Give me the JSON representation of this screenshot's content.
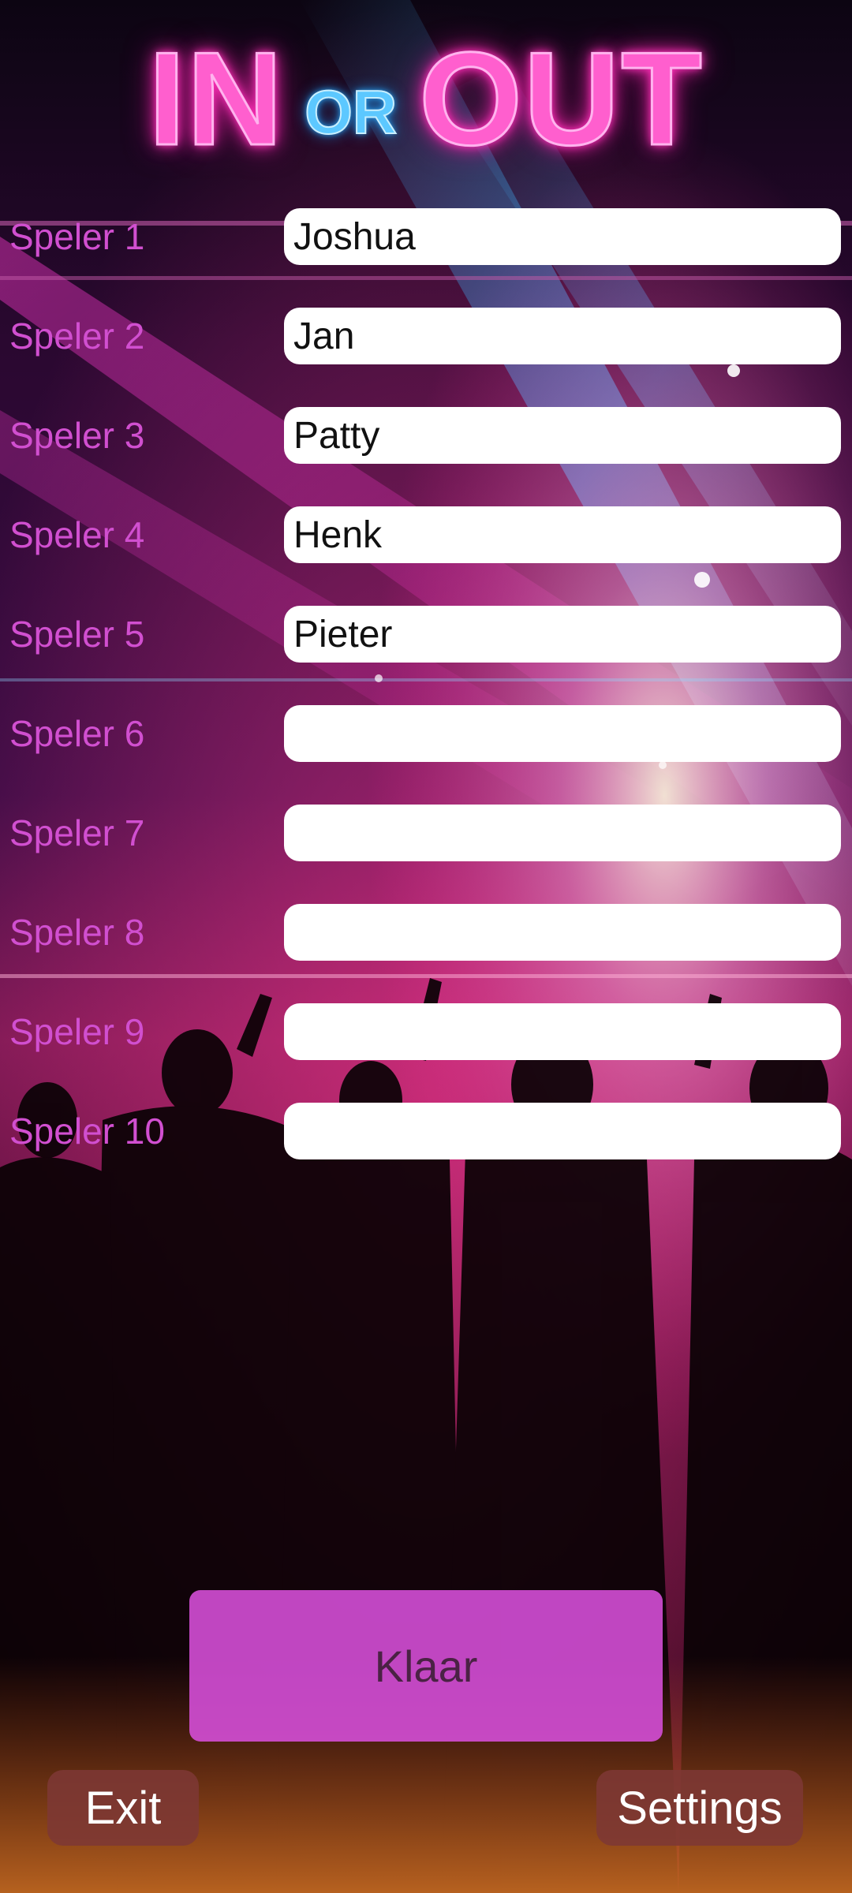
{
  "logo": {
    "word_in": "IN",
    "word_or": "OR",
    "word_out": "OUT"
  },
  "players": [
    {
      "label": "Speler 1",
      "value": "Joshua"
    },
    {
      "label": "Speler 2",
      "value": "Jan"
    },
    {
      "label": "Speler 3",
      "value": "Patty"
    },
    {
      "label": "Speler 4",
      "value": "Henk"
    },
    {
      "label": "Speler 5",
      "value": "Pieter"
    },
    {
      "label": "Speler 6",
      "value": ""
    },
    {
      "label": "Speler 7",
      "value": ""
    },
    {
      "label": "Speler 8",
      "value": ""
    },
    {
      "label": "Speler 9",
      "value": ""
    },
    {
      "label": "Speler 10",
      "value": ""
    }
  ],
  "buttons": {
    "klaar_label": "Klaar",
    "exit_label": "Exit",
    "settings_label": "Settings"
  },
  "colors": {
    "logo_pink": "#ff5fce",
    "logo_blue": "#5cc8ff",
    "label_magenta": "#d14fd0",
    "klaar_button": "#d44ed6",
    "small_button": "#7d3834"
  }
}
